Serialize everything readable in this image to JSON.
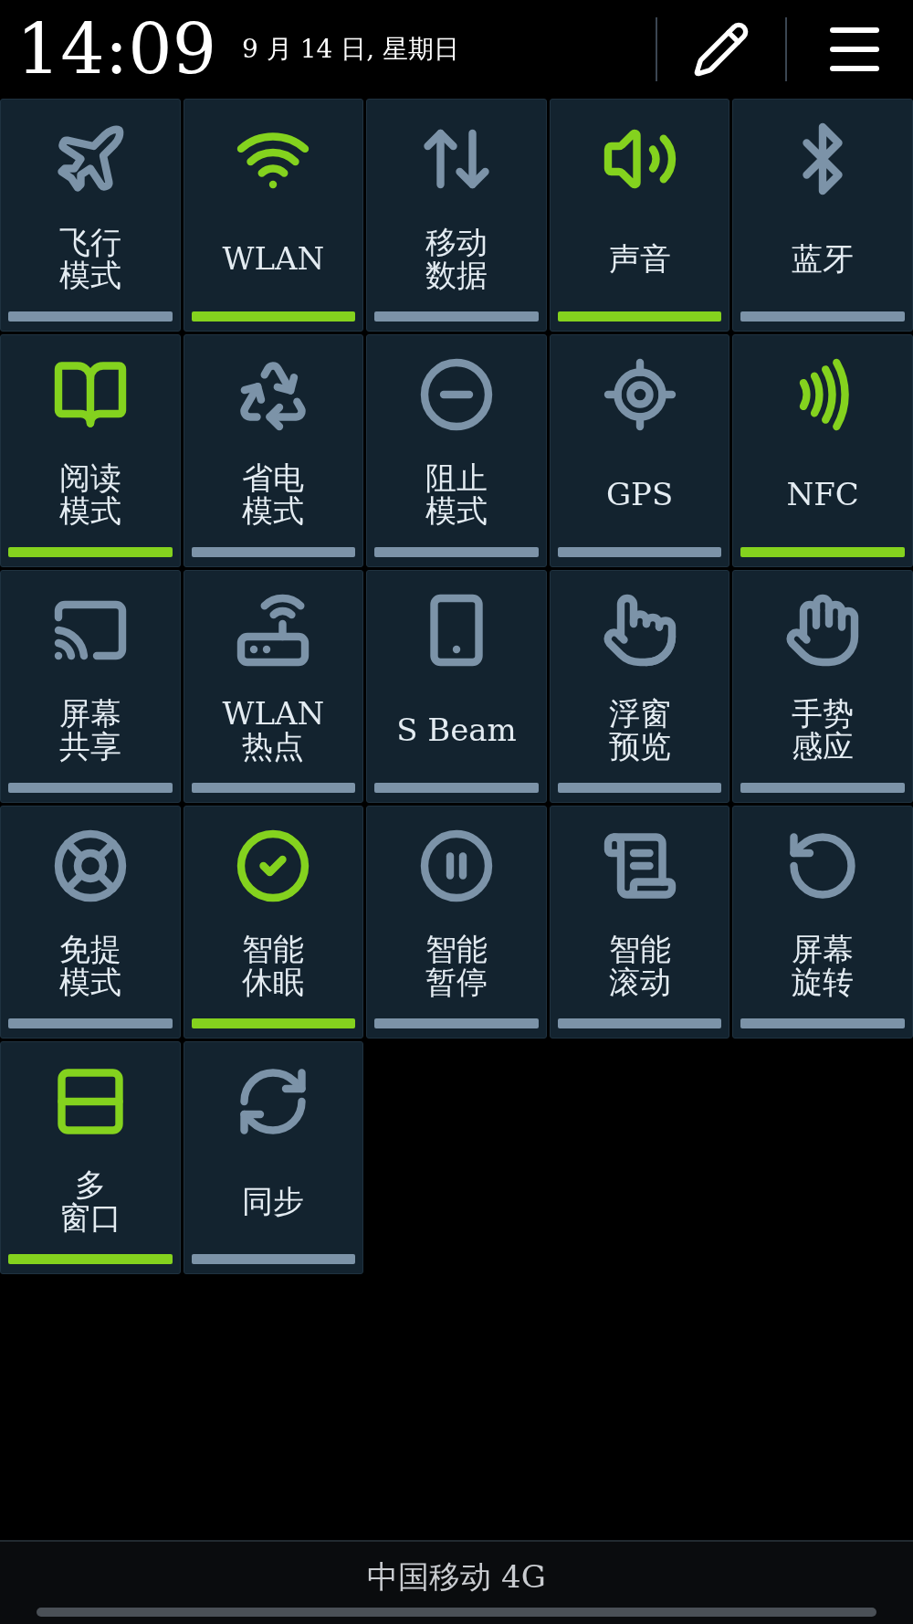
{
  "status": {
    "time": "14:09",
    "date": "9 月 14 日, 星期日"
  },
  "tiles": [
    {
      "lines": [
        "飞行",
        "模式"
      ],
      "on": false
    },
    {
      "lines": [
        "WLAN"
      ],
      "on": true
    },
    {
      "lines": [
        "移动",
        "数据"
      ],
      "on": false
    },
    {
      "lines": [
        "声音"
      ],
      "on": true
    },
    {
      "lines": [
        "蓝牙"
      ],
      "on": false
    },
    {
      "lines": [
        "阅读",
        "模式"
      ],
      "on": true
    },
    {
      "lines": [
        "省电",
        "模式"
      ],
      "on": false
    },
    {
      "lines": [
        "阻止",
        "模式"
      ],
      "on": false
    },
    {
      "lines": [
        "GPS"
      ],
      "on": false
    },
    {
      "lines": [
        "NFC"
      ],
      "on": true
    },
    {
      "lines": [
        "屏幕",
        "共享"
      ],
      "on": false
    },
    {
      "lines": [
        "WLAN",
        "热点"
      ],
      "on": false
    },
    {
      "lines": [
        "S Beam"
      ],
      "on": false
    },
    {
      "lines": [
        "浮窗",
        "预览"
      ],
      "on": false
    },
    {
      "lines": [
        "手势",
        "感应"
      ],
      "on": false
    },
    {
      "lines": [
        "免提",
        "模式"
      ],
      "on": false
    },
    {
      "lines": [
        "智能",
        "休眠"
      ],
      "on": true
    },
    {
      "lines": [
        "智能",
        "暂停"
      ],
      "on": false
    },
    {
      "lines": [
        "智能",
        "滚动"
      ],
      "on": false
    },
    {
      "lines": [
        "屏幕",
        "旋转"
      ],
      "on": false
    },
    {
      "lines": [
        "多",
        "窗口"
      ],
      "on": true
    },
    {
      "lines": [
        "同步"
      ],
      "on": false
    }
  ],
  "carrier": "中国移动 4G"
}
